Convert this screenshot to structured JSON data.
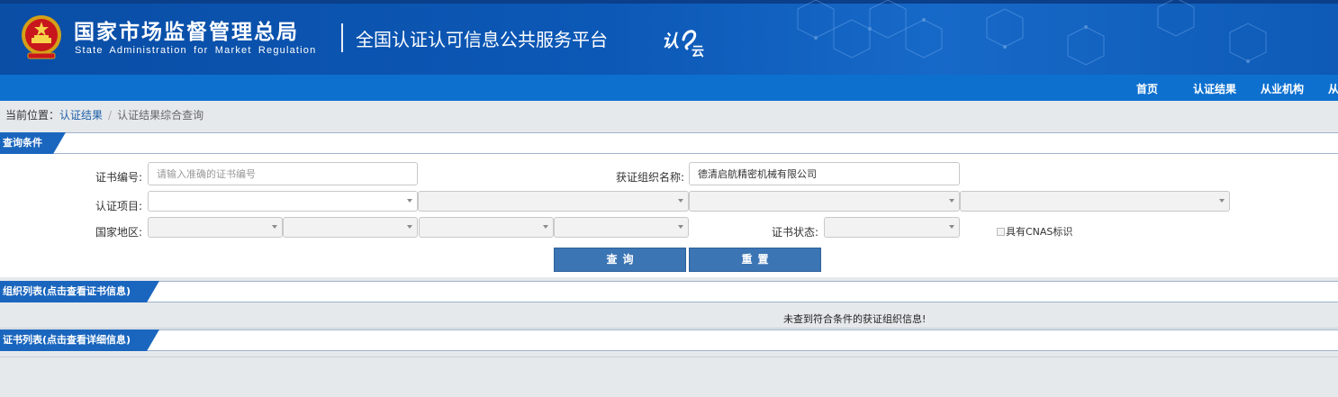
{
  "header": {
    "title_cn": "国家市场监督管理总局",
    "title_en": "State Administration  for  Market Regulation",
    "platform": "全国认证认可信息公共服务平台",
    "logo_text": "认云"
  },
  "nav": {
    "items": [
      "首页",
      "认证结果",
      "从业机构",
      "从"
    ]
  },
  "breadcrumb": {
    "prefix": "当前位置：",
    "link": "认证结果",
    "separator": "/",
    "current": "认证结果综合查询"
  },
  "query": {
    "section_title": "查询条件",
    "cert_no_label": "证书编号:",
    "cert_no_placeholder": "请输入准确的证书编号",
    "org_name_label": "获证组织名称:",
    "org_name_value": "德清启航精密机械有限公司",
    "project_label": "认证项目:",
    "region_label": "国家地区:",
    "status_label": "证书状态:",
    "cnas_label": "具有CNAS标识",
    "search_button": "查询",
    "reset_button": "重置"
  },
  "org_list": {
    "section_title": "组织列表(点击查看证书信息)",
    "empty_message": "未查到符合条件的获证组织信息!"
  },
  "cert_list": {
    "section_title": "证书列表(点击查看详细信息)"
  },
  "colors": {
    "header_blue": "#0c58b6",
    "nav_blue": "#0d70cf",
    "tab_blue": "#1a66be",
    "button_blue": "#3c75b4"
  }
}
